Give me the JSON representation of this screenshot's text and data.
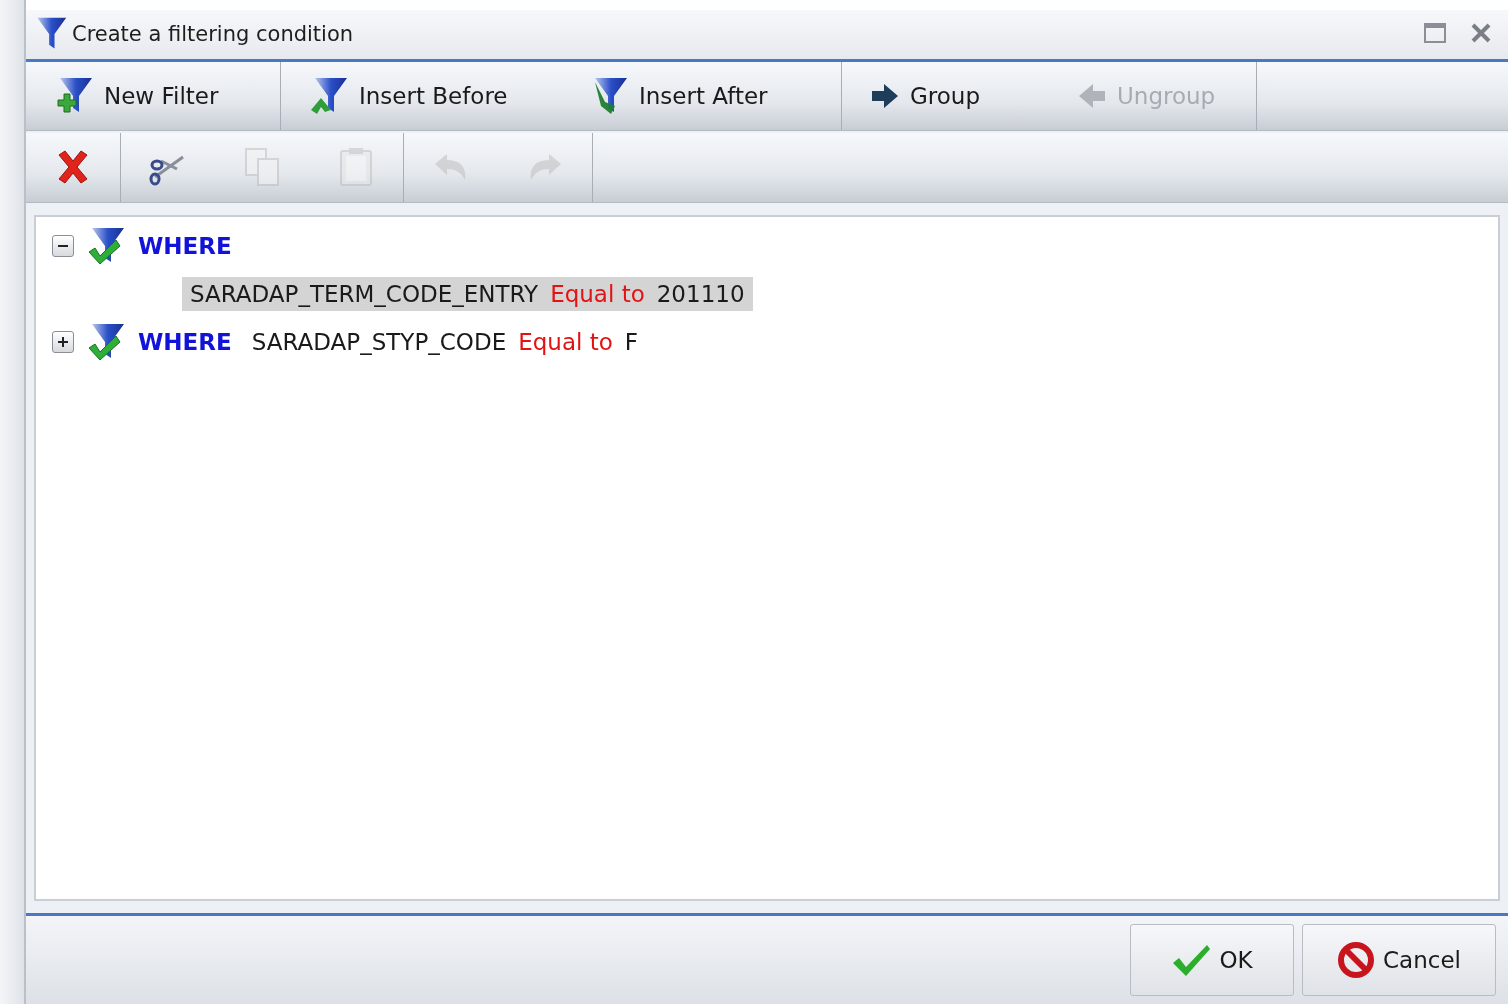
{
  "window": {
    "title": "Create a filtering condition"
  },
  "filter_toolbar": [
    {
      "buttons": [
        {
          "kind": "new",
          "label": "New Filter",
          "disabled": false
        }
      ]
    },
    {
      "buttons": [
        {
          "kind": "before",
          "label": "Insert Before",
          "disabled": false
        },
        {
          "kind": "after",
          "label": "Insert After",
          "disabled": false
        }
      ]
    },
    {
      "buttons": [
        {
          "kind": "group",
          "label": "Group",
          "disabled": false
        },
        {
          "kind": "ungroup",
          "label": "Ungroup",
          "disabled": true
        }
      ]
    }
  ],
  "edit_toolbar": [
    {
      "buttons": [
        {
          "kind": "delete",
          "disabled": false
        }
      ]
    },
    {
      "buttons": [
        {
          "kind": "cut",
          "disabled": false
        },
        {
          "kind": "copy",
          "disabled": true
        },
        {
          "kind": "paste",
          "disabled": true
        }
      ]
    },
    {
      "buttons": [
        {
          "kind": "undo",
          "disabled": true
        },
        {
          "kind": "redo",
          "disabled": true
        }
      ]
    }
  ],
  "tree": [
    {
      "keyword": "WHERE",
      "expanded": true,
      "children": [
        {
          "field": "SARADAP_TERM_CODE_ENTRY",
          "operator": "Equal to",
          "value": "201110",
          "selected": true
        }
      ]
    },
    {
      "keyword": "WHERE",
      "expanded": false,
      "field": "SARADAP_STYP_CODE",
      "operator": "Equal to",
      "value": "F"
    }
  ],
  "buttons": [
    {
      "kind": "ok",
      "label": "OK"
    },
    {
      "kind": "cancel",
      "label": "Cancel"
    }
  ]
}
